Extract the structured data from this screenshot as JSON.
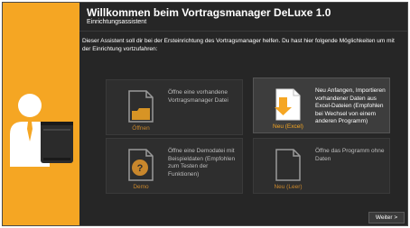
{
  "header": {
    "title": "Willkommen beim Vortragsmanager DeLuxe 1.0",
    "subtitle": "Einrichtungsassistent"
  },
  "description": "Dieser Assistent soll dir bei der Ersteinrichtung des Vortragsmanager helfen. Du hast hier folgende Möglichkeiten um mit der Einrichtung vortzufahren:",
  "options": [
    {
      "label": "Öffnen",
      "description": "Öffne eine vorhandene Vortragsmanager Datei",
      "icon": "folder-open-icon",
      "selected": false
    },
    {
      "label": "Neu (Excel)",
      "description": "Neu Anfangen, Importieren vorhandener Daten aus Excel-Dateien (Empfohlen bei Wechsel von einem anderen Programm)",
      "icon": "import-document-icon",
      "selected": true
    },
    {
      "label": "Demo",
      "description": "Öffne eine Demodatei mit Beispieldaten (Empfohlen zum Testen der Funktionen)",
      "icon": "help-document-icon",
      "selected": false
    },
    {
      "label": "Neu (Leer)",
      "description": "Öffne das Programm ohne Daten",
      "icon": "blank-document-icon",
      "selected": false
    }
  ],
  "footer": {
    "next_label": "Weiter >"
  },
  "colors": {
    "accent": "#f5a623",
    "background": "#262626",
    "tile": "#2e2e2e",
    "tile_selected": "#3d3d3d"
  }
}
